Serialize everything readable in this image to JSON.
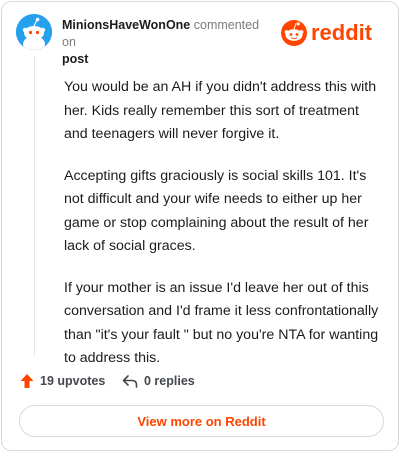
{
  "header": {
    "username": "MinionsHaveWonOne",
    "action_text": "commented on",
    "post_link": "post",
    "brand": "reddit"
  },
  "comment": {
    "paragraphs": [
      "You would be an AH if you didn't address this with her. Kids really remember this sort of treatment and teenagers will never forgive it.",
      "Accepting gifts graciously is social skills 101. It's not difficult and your wife needs to either up her game or stop complaining about the result of her lack of social graces.",
      "If your mother is an issue I'd leave her out of this conversation and I'd frame it less confrontationally than \"it's your fault \" but no you're NTA for wanting to address this."
    ]
  },
  "actions": {
    "upvotes": "19 upvotes",
    "replies": "0 replies"
  },
  "footer": {
    "view_more": "View more on Reddit"
  },
  "colors": {
    "brand": "#ff4500",
    "avatar_bg": "#24a0ed"
  },
  "icons": [
    "snoo-avatar-icon",
    "reddit-logo-icon",
    "upvote-arrow-icon",
    "reply-icon"
  ]
}
